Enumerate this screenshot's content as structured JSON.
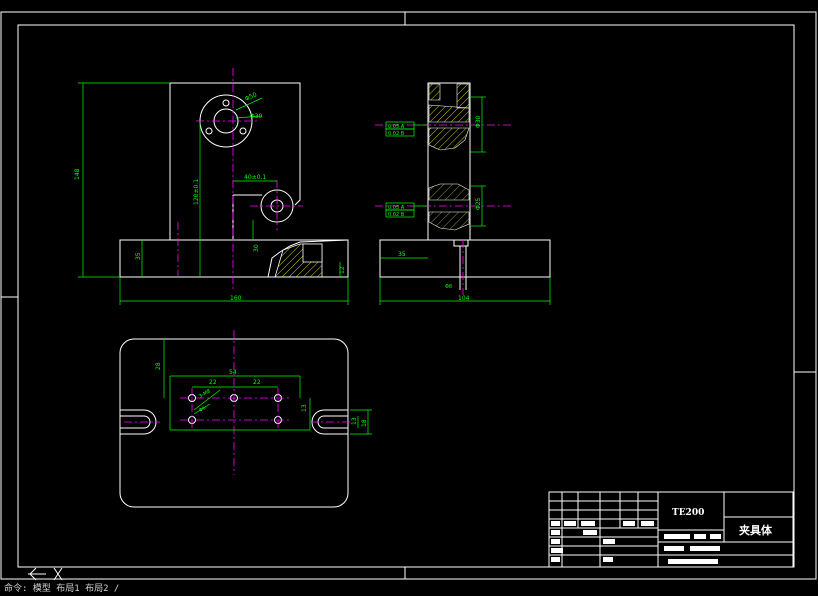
{
  "colors": {
    "background": "#000000",
    "outline": "#ffffff",
    "dimension": "#00ff00",
    "centerline": "#ff00ff",
    "hatch": "#ffff00"
  },
  "title_block": {
    "drawing_number": "TE200",
    "part_name": "夹具体"
  },
  "views": {
    "front": {
      "dims": {
        "total_height": "148",
        "base_height": "35",
        "bore_center_height": "120±0.1",
        "hole_offset": "40±0.1",
        "step_height": "30",
        "flange_dia": "Φ50",
        "bore_dia": "Φ30",
        "total_width": "160",
        "slot_depth": "12"
      }
    },
    "side": {
      "dims": {
        "upper_bore": "Φ30",
        "lower_bore": "Φ25",
        "bottom_width": "35",
        "total_width": "104",
        "pin_dia": "Φ8"
      },
      "tolerances": {
        "upper_a": "0.05 A",
        "upper_b": "0.02 B",
        "lower_a": "0.05 A",
        "lower_b": "0.02 B"
      }
    },
    "top": {
      "dims": {
        "hole_span": "54",
        "pitch_left": "22",
        "pitch_right": "22",
        "hole_spec": "3-M8",
        "hole_dia": "Φ6",
        "edge_offset": "28",
        "row_offset": "13",
        "slot_width": "13",
        "slot_len": "18"
      }
    }
  },
  "command_line": "命令: 模型 布局1 布局2 /"
}
